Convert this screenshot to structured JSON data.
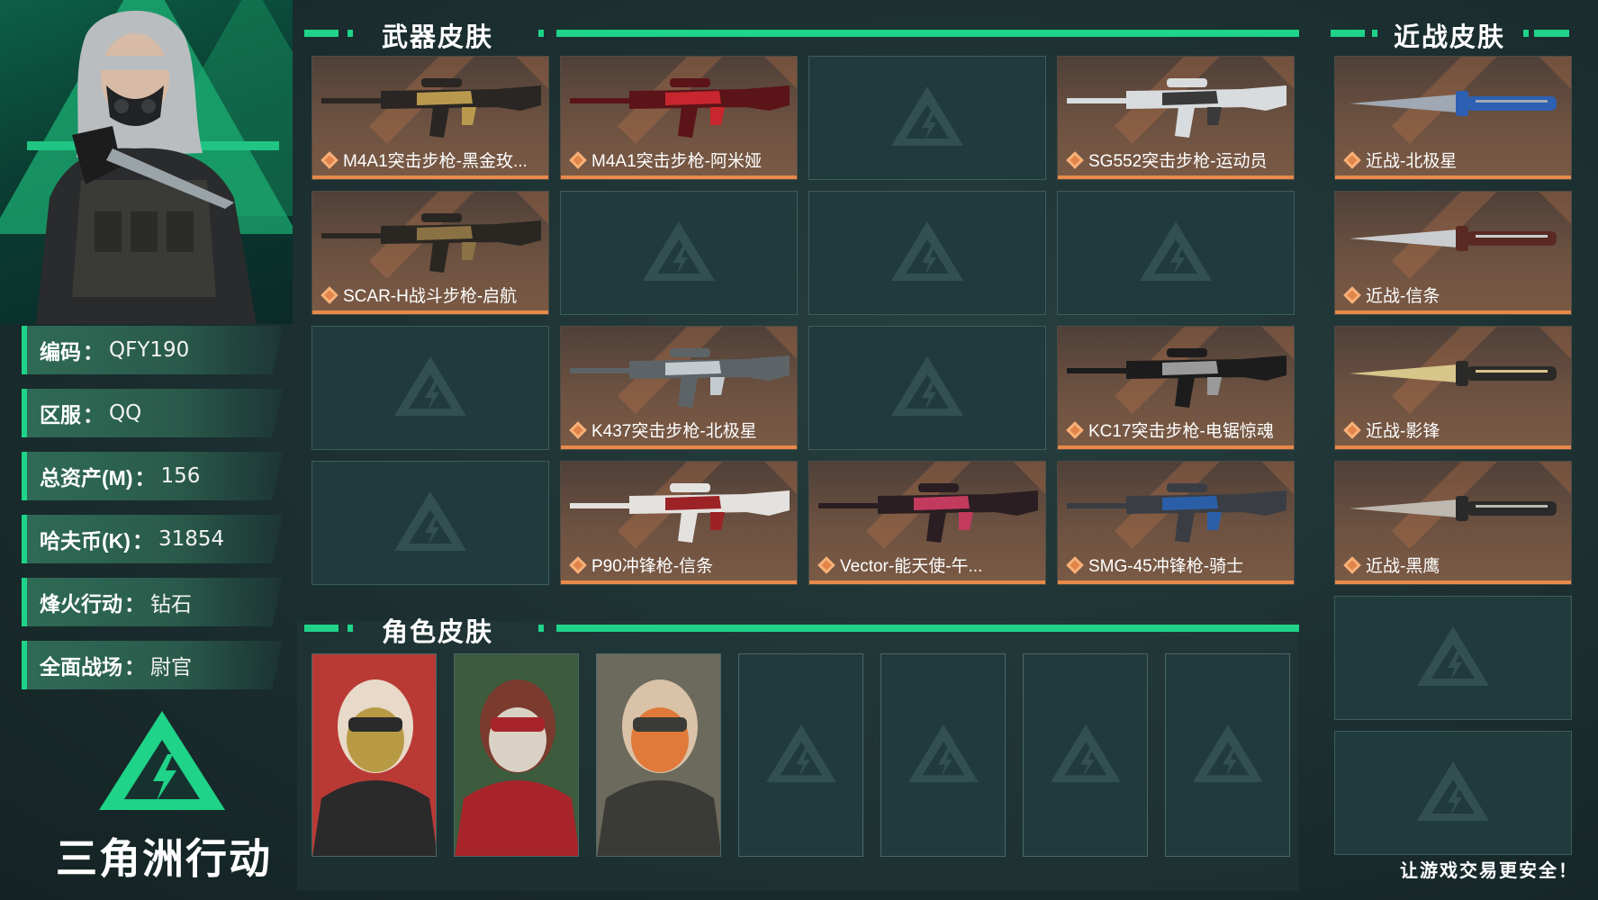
{
  "profile": {
    "fields": [
      {
        "label": "编码",
        "value": "QFY190"
      },
      {
        "label": "区服",
        "value": "QQ"
      },
      {
        "label": "总资产(M)",
        "value": "156"
      },
      {
        "label": "哈夫币(K)",
        "value": "31854"
      },
      {
        "label": "烽火行动",
        "value": "钻石"
      },
      {
        "label": "全面战场",
        "value": "尉官"
      }
    ],
    "separator": "："
  },
  "brand": {
    "name": "三角洲行动"
  },
  "weapon_section": {
    "title": "武器皮肤",
    "slots": [
      {
        "label": "M4A1突击步枪-黑金玫...",
        "icon": "rifle-gold-icon"
      },
      {
        "label": "M4A1突击步枪-阿米娅",
        "icon": "rifle-red-icon"
      },
      {
        "label": null
      },
      {
        "label": "SG552突击步枪-运动员",
        "icon": "rifle-white-icon"
      },
      {
        "label": "SCAR-H战斗步枪-启航",
        "icon": "rifle-dark-icon"
      },
      {
        "label": null
      },
      {
        "label": null
      },
      {
        "label": null
      },
      {
        "label": null
      },
      {
        "label": "K437突击步枪-北极星",
        "icon": "rifle-grey-icon"
      },
      {
        "label": null
      },
      {
        "label": "KC17突击步枪-电锯惊魂",
        "icon": "rifle-black-icon"
      },
      {
        "label": null
      },
      {
        "label": "P90冲锋枪-信条",
        "icon": "smg-red-icon"
      },
      {
        "label": "Vector-能天使-午...",
        "icon": "smg-pink-icon"
      },
      {
        "label": "SMG-45冲锋枪-骑士",
        "icon": "smg-blue-icon"
      }
    ]
  },
  "melee_section": {
    "title": "近战皮肤",
    "slots": [
      {
        "label": "近战-北极星",
        "icon": "knife-blue-icon"
      },
      {
        "label": "近战-信条",
        "icon": "knife-knuckle-icon"
      },
      {
        "label": "近战-影锋",
        "icon": "knife-gold-icon"
      },
      {
        "label": "近战-黑鹰",
        "icon": "knife-combat-icon"
      },
      {
        "label": null
      },
      {
        "label": null
      }
    ]
  },
  "role_section": {
    "title": "角色皮肤",
    "slots": [
      {
        "filled": true,
        "icon": "operator-gold-mask-icon"
      },
      {
        "filled": true,
        "icon": "operator-jigsaw-icon"
      },
      {
        "filled": true,
        "icon": "operator-goggles-icon"
      },
      {
        "filled": false
      },
      {
        "filled": false
      },
      {
        "filled": false
      },
      {
        "filled": false
      }
    ]
  },
  "footer": {
    "text": "让游戏交易更安全！"
  },
  "colors": {
    "accent": "#1fd388",
    "card_orange": "#e88a4a",
    "background": "#1b2e30"
  }
}
